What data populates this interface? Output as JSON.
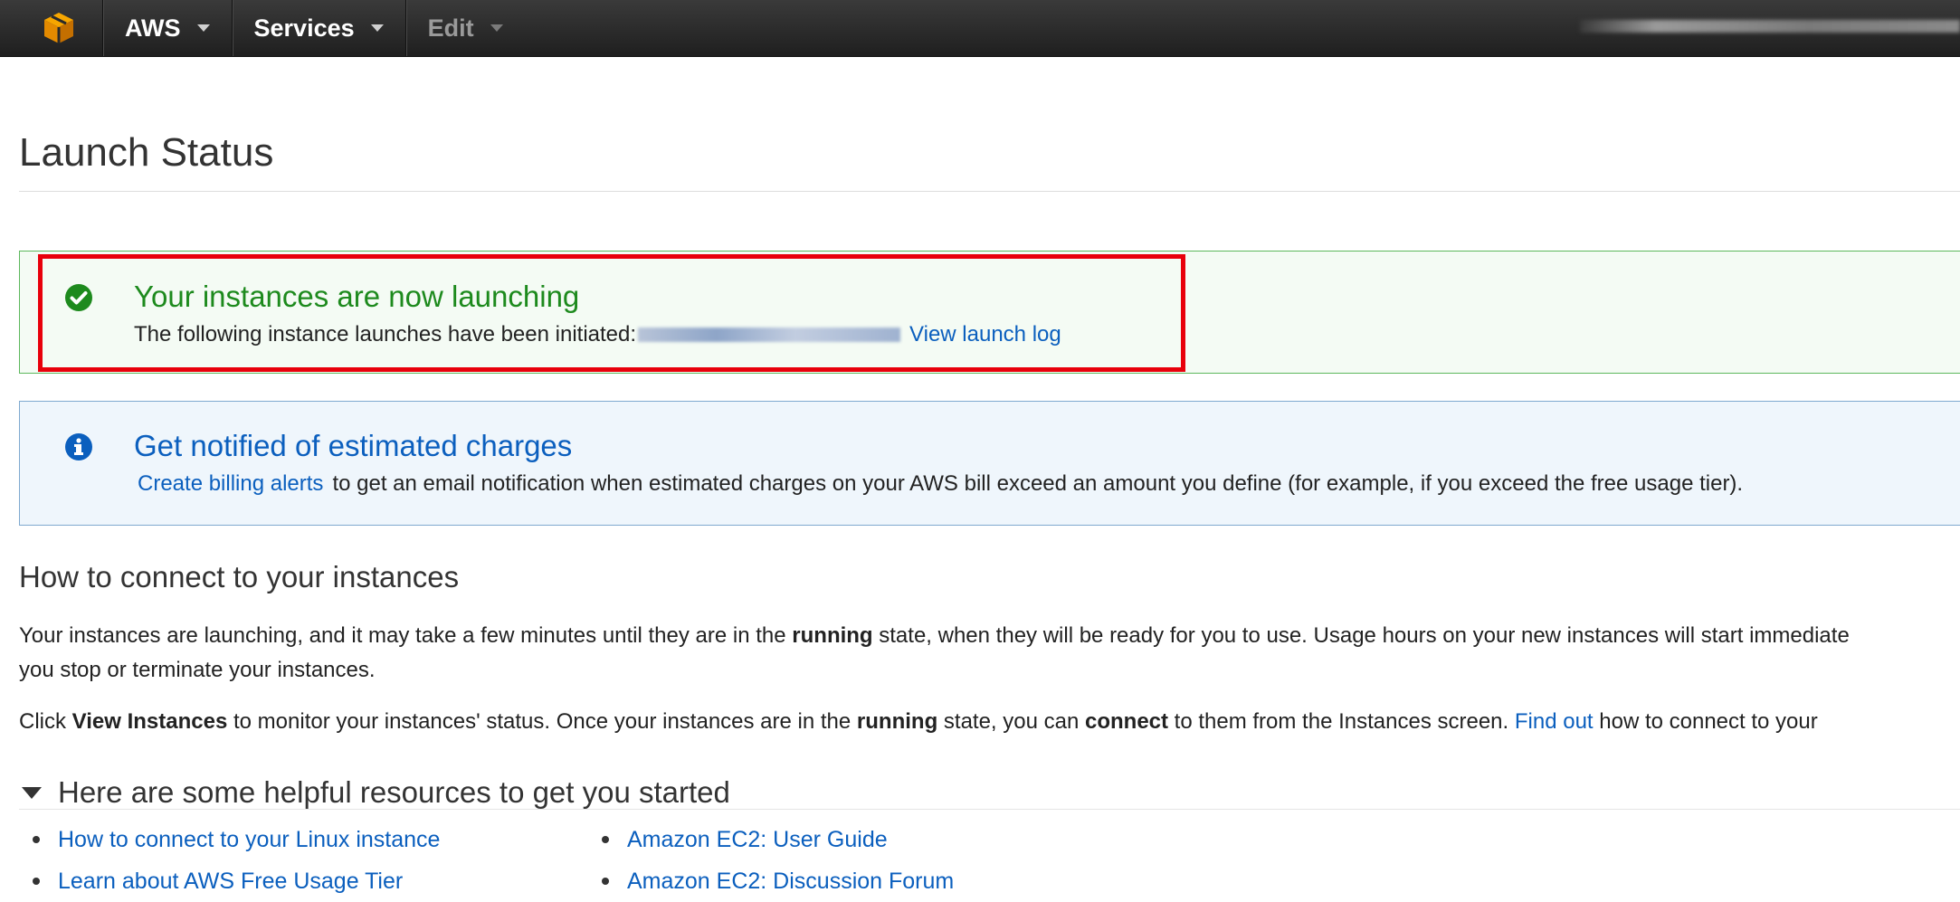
{
  "nav": {
    "brand": "AWS",
    "services": "Services",
    "edit": "Edit"
  },
  "page": {
    "title": "Launch Status"
  },
  "success": {
    "title": "Your instances are now launching",
    "text": "The following instance launches have been initiated:",
    "link": "View launch log",
    "color": "#1d8a1d"
  },
  "billing": {
    "title": "Get notified of estimated charges",
    "link": "Create billing alerts",
    "text": "to get an email notification when estimated charges on your AWS bill exceed an amount you define (for example, if you exceed the free usage tier)."
  },
  "connect": {
    "heading": "How to connect to your instances",
    "p1_a": "Your instances are launching, and it may take a few minutes until they are in the ",
    "p1_b": "running",
    "p1_c": " state, when they will be ready for you to use. Usage hours on your new instances will start immediate",
    "p1_d": "you stop or terminate your instances.",
    "p2_a": "Click ",
    "p2_b": "View Instances",
    "p2_c": " to monitor your instances' status. Once your instances are in the ",
    "p2_d": "running",
    "p2_e": " state, you can ",
    "p2_f": "connect",
    "p2_g": " to them from the Instances screen. ",
    "p2_link": "Find out",
    "p2_h": " how to connect to your"
  },
  "resources": {
    "title": "Here are some helpful resources to get you started",
    "left": [
      "How to connect to your Linux instance",
      "Learn about AWS Free Usage Tier"
    ],
    "right": [
      "Amazon EC2: User Guide",
      "Amazon EC2: Discussion Forum"
    ]
  }
}
